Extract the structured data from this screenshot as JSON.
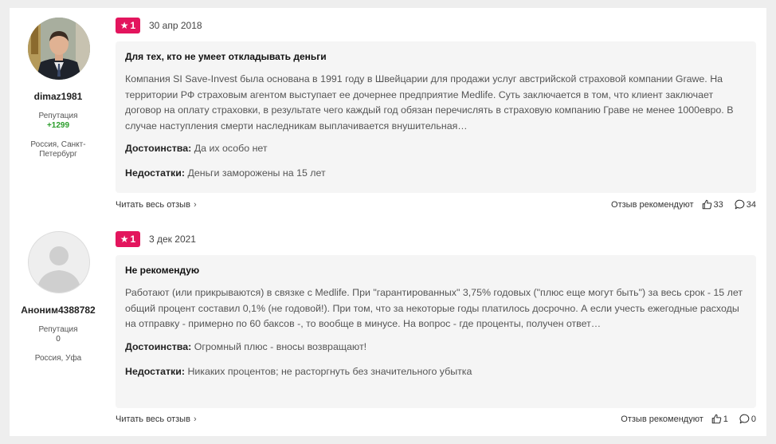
{
  "reviews": [
    {
      "author": {
        "username": "dimaz1981",
        "reputation_label": "Репутация",
        "reputation_value": "+1299",
        "location": "Россия, Санкт-Петербург"
      },
      "rating": "1",
      "date": "30 апр 2018",
      "title": "Для тех, кто не умеет откладывать деньги",
      "body": "Компания SI Save-Invest была основана в 1991 году в Швейцарии для продажи услуг австрийской страховой компании Grawe. На территории РФ страховым агентом выступает ее дочернее предприятие Medlife. Суть заключается в том, что клиент заключает договор на оплату страховки, в результате чего каждый год обязан перечислять в страховую компанию Граве не менее 1000евро. В случае наступления смерти наследникам выплачивается внушительная…",
      "pros_label": "Достоинства:",
      "pros": "Да их особо нет",
      "cons_label": "Недостатки:",
      "cons": "Деньги заморожены на 15 лет",
      "read_more": "Читать весь отзыв",
      "recommend_label": "Отзыв рекомендуют",
      "likes": "33",
      "comments": "34"
    },
    {
      "author": {
        "username": "Аноним4388782",
        "reputation_label": "Репутация",
        "reputation_value": "0",
        "location": "Россия, Уфа"
      },
      "rating": "1",
      "date": "3 дек 2021",
      "title": "Не рекомендую",
      "body": "Работают (или прикрываются) в связке с Medlife. При \"гарантированных\" 3,75% годовых (\"плюс еще могут быть\") за весь срок - 15 лет общий процент составил 0,1% (не годовой!). При том, что за некоторые годы платилось досрочно. А если учесть ежегодные расходы на отправку - примерно по 60 баксов -, то вообще в минусе. На вопрос - где проценты, получен ответ…",
      "pros_label": "Достоинства:",
      "pros": "Огромный плюс - вносы возвращают!",
      "cons_label": "Недостатки:",
      "cons": "Никаких процентов; не расторгнуть без значительного убытка",
      "read_more": "Читать весь отзыв",
      "recommend_label": "Отзыв рекомендуют",
      "likes": "1",
      "comments": "0"
    }
  ],
  "icons": {
    "rating": "star-icon",
    "read_more": "chevron-right-icon",
    "likes": "thumbs-up-icon",
    "comments": "comment-bubble-icon"
  },
  "colors": {
    "rating_badge": "#e3155d",
    "reputation_positive": "#2a9d2a",
    "card_background": "#f5f5f5"
  }
}
